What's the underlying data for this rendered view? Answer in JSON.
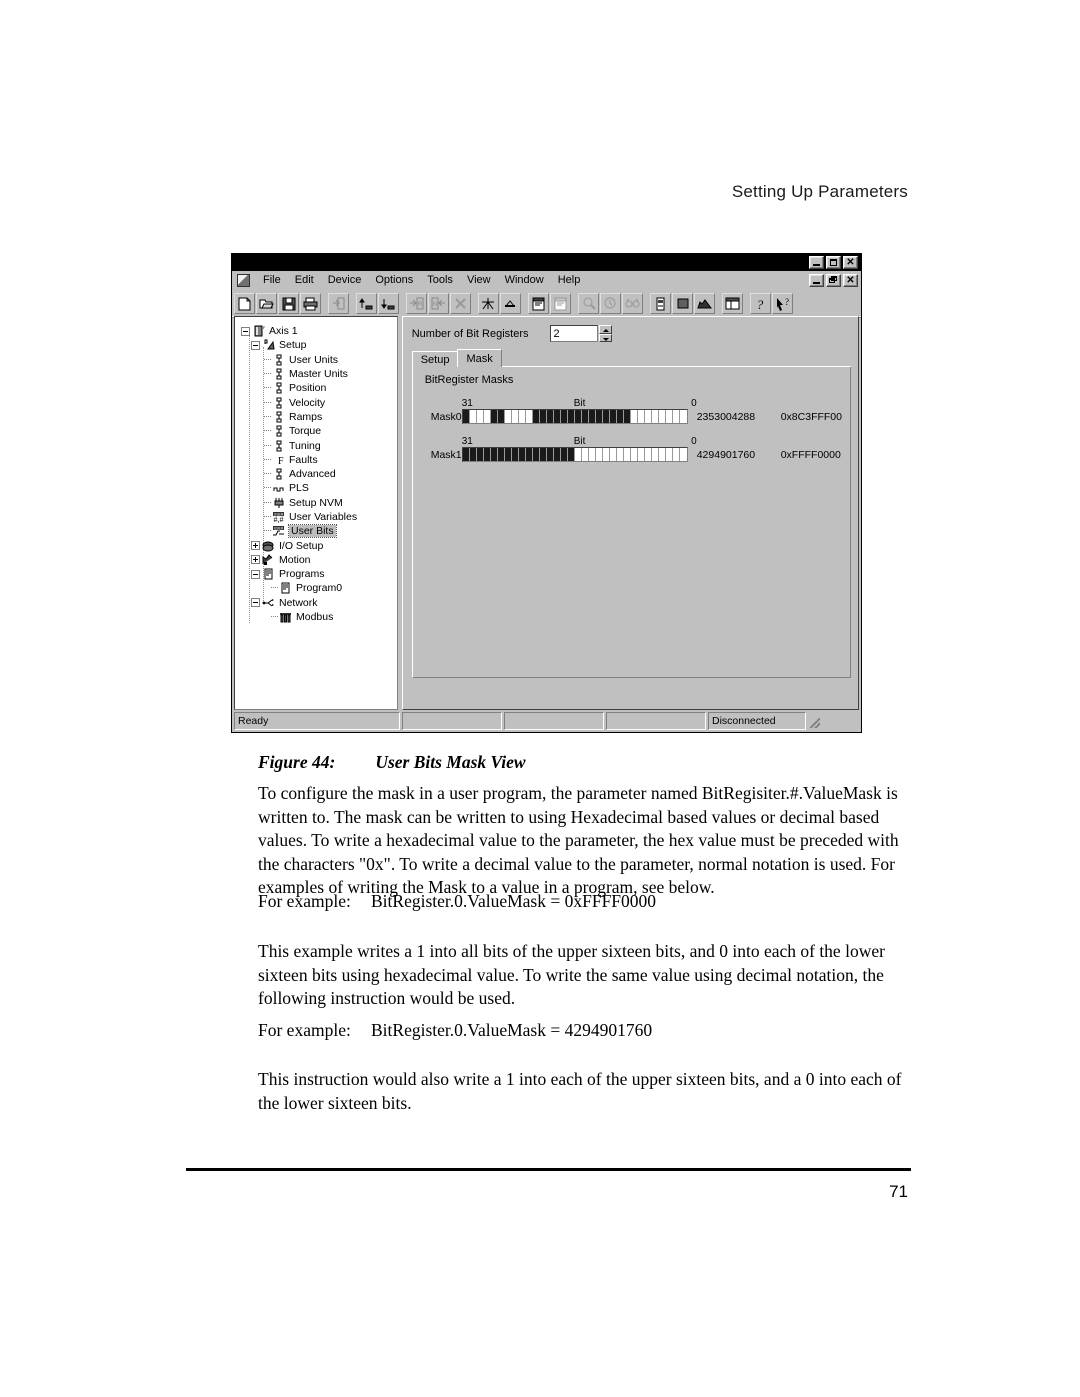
{
  "page": {
    "header": "Setting Up Parameters",
    "number": "71"
  },
  "figure": {
    "number": "Figure 44:",
    "title": "User Bits Mask View"
  },
  "window": {
    "title": "",
    "titlebar_buttons": [
      {
        "name": "minimize",
        "glyph": "_"
      },
      {
        "name": "maximize",
        "glyph": "□"
      },
      {
        "name": "close",
        "glyph": "✕"
      }
    ],
    "mdi_buttons": [
      {
        "name": "minimize",
        "glyph": "_"
      },
      {
        "name": "restore",
        "glyph": "❐"
      },
      {
        "name": "close",
        "glyph": "✕"
      }
    ],
    "menu": [
      "File",
      "Edit",
      "Device",
      "Options",
      "Tools",
      "View",
      "Window",
      "Help"
    ],
    "toolbar": [
      "new-document-icon",
      "open-folder-icon",
      "save-disk-icon",
      "print-icon",
      "download-to-device-icon",
      "upload-arrow-icon",
      "download-arrow-icon",
      "goto-ram-icon",
      "from-nvm-icon",
      "cancel-x-icon",
      "expand-tree-icon",
      "collapse-tree-icon",
      "copy-parameters-icon",
      "paste-parameters-icon",
      "zoom-icon",
      "watch-icon",
      "find-icon",
      "motor-icon",
      "stop-icon",
      "run-icon",
      "window-layout-icon",
      "help-icon",
      "context-help-icon"
    ],
    "statusbar": {
      "ready": "Ready",
      "pane2": "",
      "pane3": "",
      "pane4": "",
      "connection": "Disconnected"
    }
  },
  "tree": {
    "nodes": [
      {
        "label": "Axis 1",
        "indent": 0,
        "expander": "minus",
        "icon": "axis-icon",
        "selected": false
      },
      {
        "label": "Setup",
        "indent": 1,
        "expander": "minus",
        "icon": "setup-icon",
        "selected": false
      },
      {
        "label": "User Units",
        "indent": 2,
        "expander": "none",
        "icon": "parameter-icon",
        "selected": false
      },
      {
        "label": "Master Units",
        "indent": 2,
        "expander": "none",
        "icon": "parameter-icon",
        "selected": false
      },
      {
        "label": "Position",
        "indent": 2,
        "expander": "none",
        "icon": "parameter-icon",
        "selected": false
      },
      {
        "label": "Velocity",
        "indent": 2,
        "expander": "none",
        "icon": "parameter-icon",
        "selected": false
      },
      {
        "label": "Ramps",
        "indent": 2,
        "expander": "none",
        "icon": "parameter-icon",
        "selected": false
      },
      {
        "label": "Torque",
        "indent": 2,
        "expander": "none",
        "icon": "parameter-icon",
        "selected": false
      },
      {
        "label": "Tuning",
        "indent": 2,
        "expander": "none",
        "icon": "parameter-icon",
        "selected": false
      },
      {
        "label": "Faults",
        "indent": 2,
        "expander": "none",
        "icon": "faults-icon",
        "selected": false
      },
      {
        "label": "Advanced",
        "indent": 2,
        "expander": "none",
        "icon": "parameter-icon",
        "selected": false
      },
      {
        "label": "PLS",
        "indent": 2,
        "expander": "none",
        "icon": "pls-icon",
        "selected": false
      },
      {
        "label": "Setup NVM",
        "indent": 2,
        "expander": "none",
        "icon": "nvm-icon",
        "selected": false
      },
      {
        "label": "User Variables",
        "indent": 2,
        "expander": "none",
        "icon": "user-variables-icon",
        "selected": false
      },
      {
        "label": "User Bits",
        "indent": 2,
        "expander": "none",
        "icon": "user-bits-icon",
        "selected": true
      },
      {
        "label": "I/O Setup",
        "indent": 1,
        "expander": "plus",
        "icon": "io-setup-icon",
        "selected": false
      },
      {
        "label": "Motion",
        "indent": 1,
        "expander": "plus",
        "icon": "motion-icon",
        "selected": false
      },
      {
        "label": "Programs",
        "indent": 1,
        "expander": "minus",
        "icon": "programs-icon",
        "selected": false
      },
      {
        "label": "Program0",
        "indent": 2,
        "expander": "none",
        "icon": "program-icon",
        "selected": false
      },
      {
        "label": "Network",
        "indent": 1,
        "expander": "minus",
        "icon": "network-icon",
        "selected": false
      },
      {
        "label": "Modbus",
        "indent": 2,
        "expander": "none",
        "icon": "modbus-icon",
        "selected": false
      }
    ]
  },
  "panel": {
    "number_of_bit_registers_label": "Number of Bit Registers",
    "number_of_bit_registers_value": "2",
    "tabs": [
      {
        "label": "Setup",
        "active": false
      },
      {
        "label": "Mask",
        "active": true
      }
    ],
    "group_title": "BitRegister Masks",
    "scale": {
      "high": "31",
      "middle": "Bit",
      "low": "0"
    },
    "masks": [
      {
        "name": "Mask0",
        "decimal": "2353004288",
        "hex": "0x8C3FFF00",
        "bits": "10001100001111111111111100000000"
      },
      {
        "name": "Mask1",
        "decimal": "4294901760",
        "hex": "0xFFFF0000",
        "bits": "11111111111111110000000000000000"
      }
    ]
  },
  "body": {
    "paragraph1": "To configure the mask in a user program, the parameter named BitRegisiter.#.ValueMask is written to. The mask can be written to using Hexadecimal based values or decimal based values. To write a hexadecimal value to the parameter, the hex value must be preceded with the characters \"0x\". To write a decimal value to the parameter, normal notation is used. For examples of writing the Mask to a value in a program, see below.",
    "example1_label": "For example:",
    "example1_code": "BitRegister.0.ValueMask = 0xFFFF0000",
    "paragraph2": "This example writes a 1 into all bits of the upper sixteen bits, and 0 into each of the lower sixteen bits using hexadecimal value. To write the same value using decimal notation, the following instruction would be used.",
    "example2_label": "For example:",
    "example2_code": "BitRegister.0.ValueMask = 4294901760",
    "paragraph3": "This instruction would also write a 1 into each of the upper sixteen bits, and a 0 into each of the lower sixteen bits."
  }
}
